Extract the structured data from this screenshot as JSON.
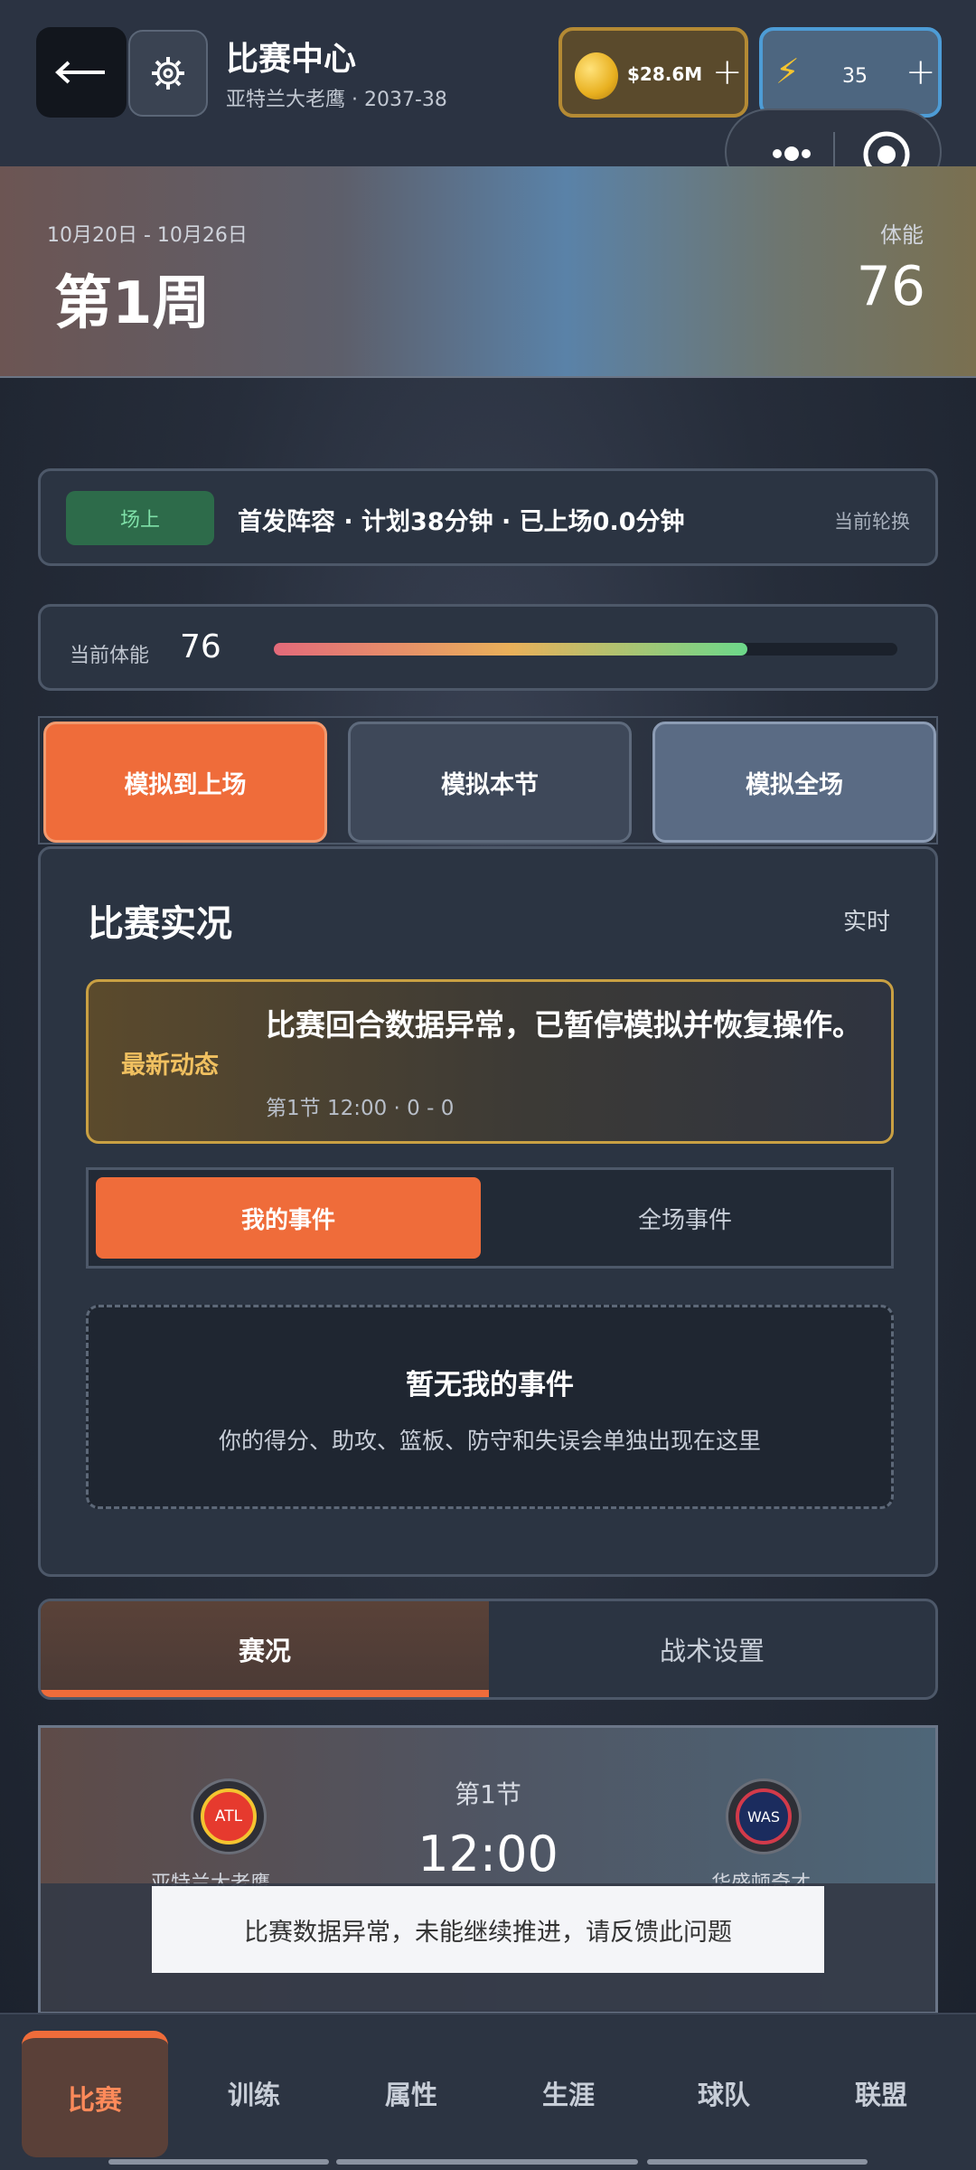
{
  "header": {
    "title": "比赛中心",
    "subtitle": "亚特兰大老鹰 · 2037-38",
    "coins": "$28.6M",
    "energy": "35",
    "plus": "+"
  },
  "banner": {
    "date_range": "10月20日 - 10月26日",
    "week": "第1周",
    "stamina_label": "体能",
    "stamina_value": "76"
  },
  "lineup": {
    "tag": "场上",
    "text": "首发阵容 · 计划38分钟 · 已上场0.0分钟",
    "right": "当前轮换"
  },
  "stamina": {
    "label": "当前体能",
    "value": "76",
    "level_percent": 76
  },
  "sim": {
    "to_court": "模拟到上场",
    "quarter": "模拟本节",
    "full": "模拟全场"
  },
  "live": {
    "title": "比赛实况",
    "realtime": "实时",
    "alert_tag": "最新动态",
    "alert_text": "比赛回合数据异常，已暂停模拟并恢复操作。",
    "alert_meta": "第1节 12:00 · 0 - 0",
    "seg_mine": "我的事件",
    "seg_all": "全场事件",
    "empty_title": "暂无我的事件",
    "empty_sub": "你的得分、助攻、篮板、防守和失误会单独出现在这里"
  },
  "tabs": {
    "game": "赛况",
    "tactics": "战术设置"
  },
  "scoreboard": {
    "quarter": "第1节",
    "clock": "12:00",
    "home_abbr": "ATL",
    "home_name": "亚特兰大老鹰",
    "away_abbr": "WAS",
    "away_name": "华盛顿奇才"
  },
  "toast": "比赛数据异常，未能继续推进，请反馈此问题",
  "nav": {
    "items": [
      "比赛",
      "训练",
      "属性",
      "生涯",
      "球队",
      "联盟"
    ]
  },
  "colors": {
    "accent": "#ef6c3a",
    "panel": "#2b3442",
    "gold": "#c9a043"
  }
}
